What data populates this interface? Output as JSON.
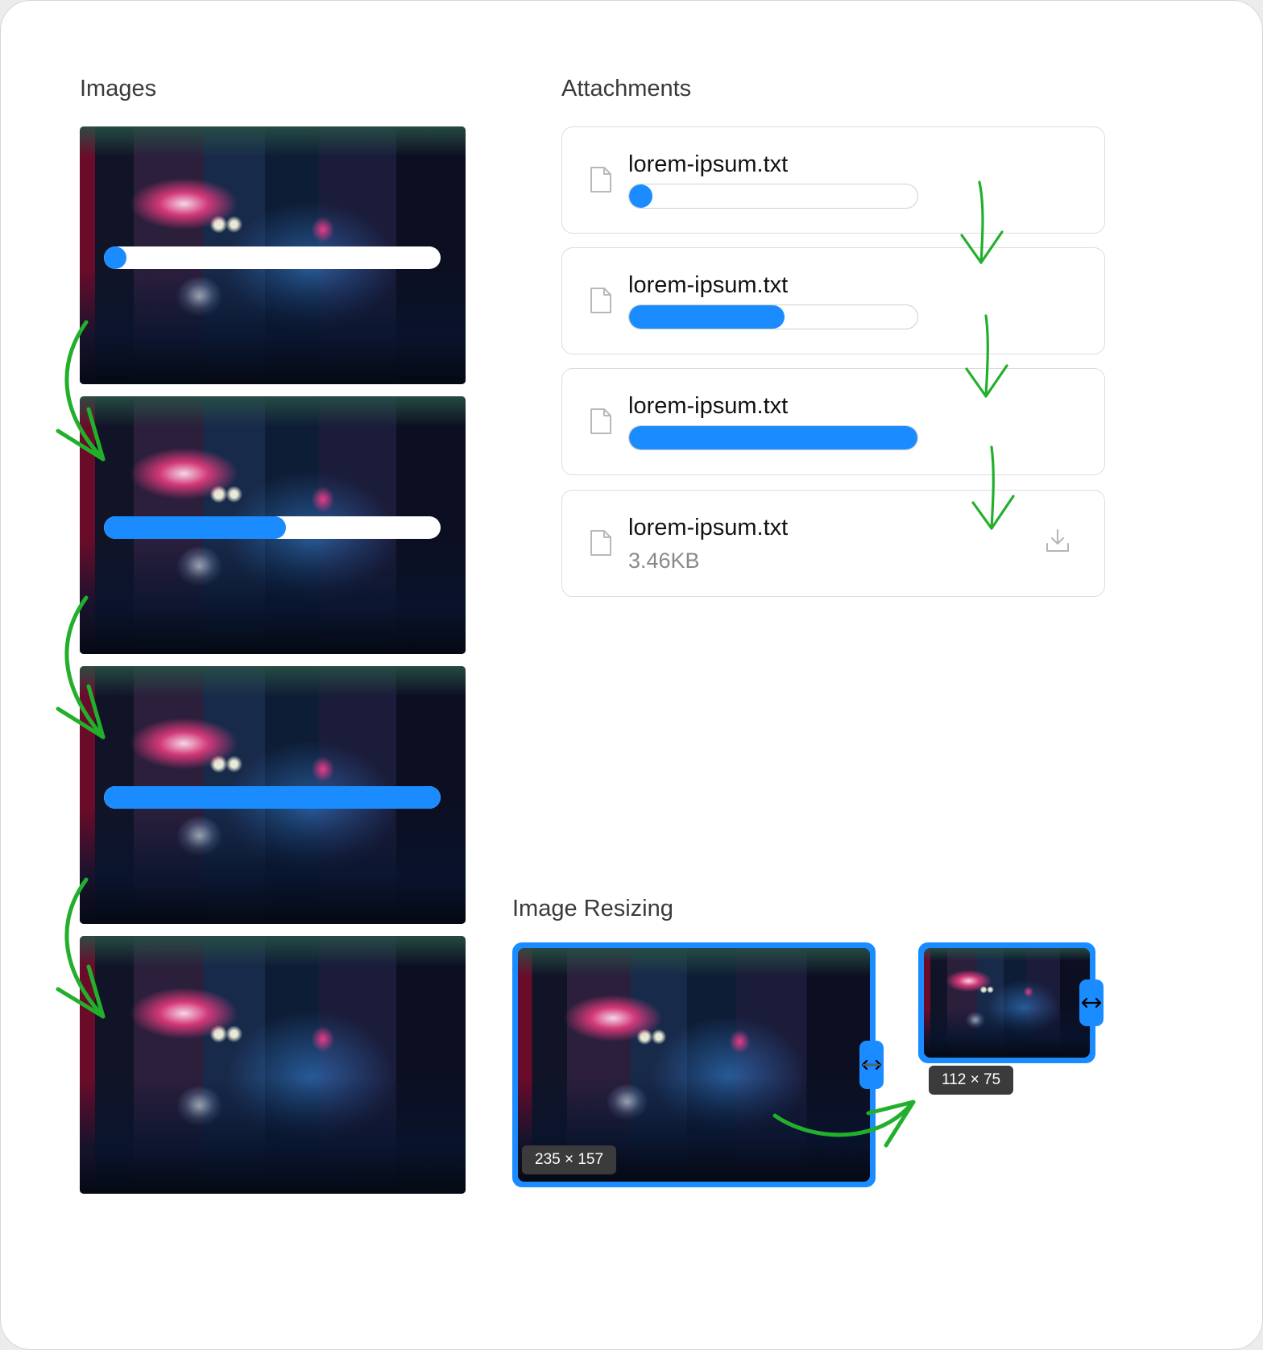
{
  "images_section": {
    "title": "Images",
    "steps": [
      {
        "progress": 0.04
      },
      {
        "progress": 0.54
      },
      {
        "progress": 1.0
      },
      {
        "progress": null
      }
    ]
  },
  "attachments_section": {
    "title": "Attachments",
    "items": [
      {
        "file_name": "lorem-ipsum.txt",
        "progress": 0.04,
        "state": "uploading"
      },
      {
        "file_name": "lorem-ipsum.txt",
        "progress": 0.54,
        "state": "uploading"
      },
      {
        "file_name": "lorem-ipsum.txt",
        "progress": 1.0,
        "state": "uploading"
      },
      {
        "file_name": "lorem-ipsum.txt",
        "size": "3.46KB",
        "state": "complete",
        "action_icon": "download-icon"
      }
    ]
  },
  "resizing_section": {
    "title": "Image Resizing",
    "before": {
      "dimensions": "235 × 157"
    },
    "after": {
      "dimensions": "112 × 75"
    }
  },
  "colors": {
    "accent": "#1a8cff",
    "annotation_arrows": "#22b02c",
    "label_background": "#3b3b3b"
  }
}
